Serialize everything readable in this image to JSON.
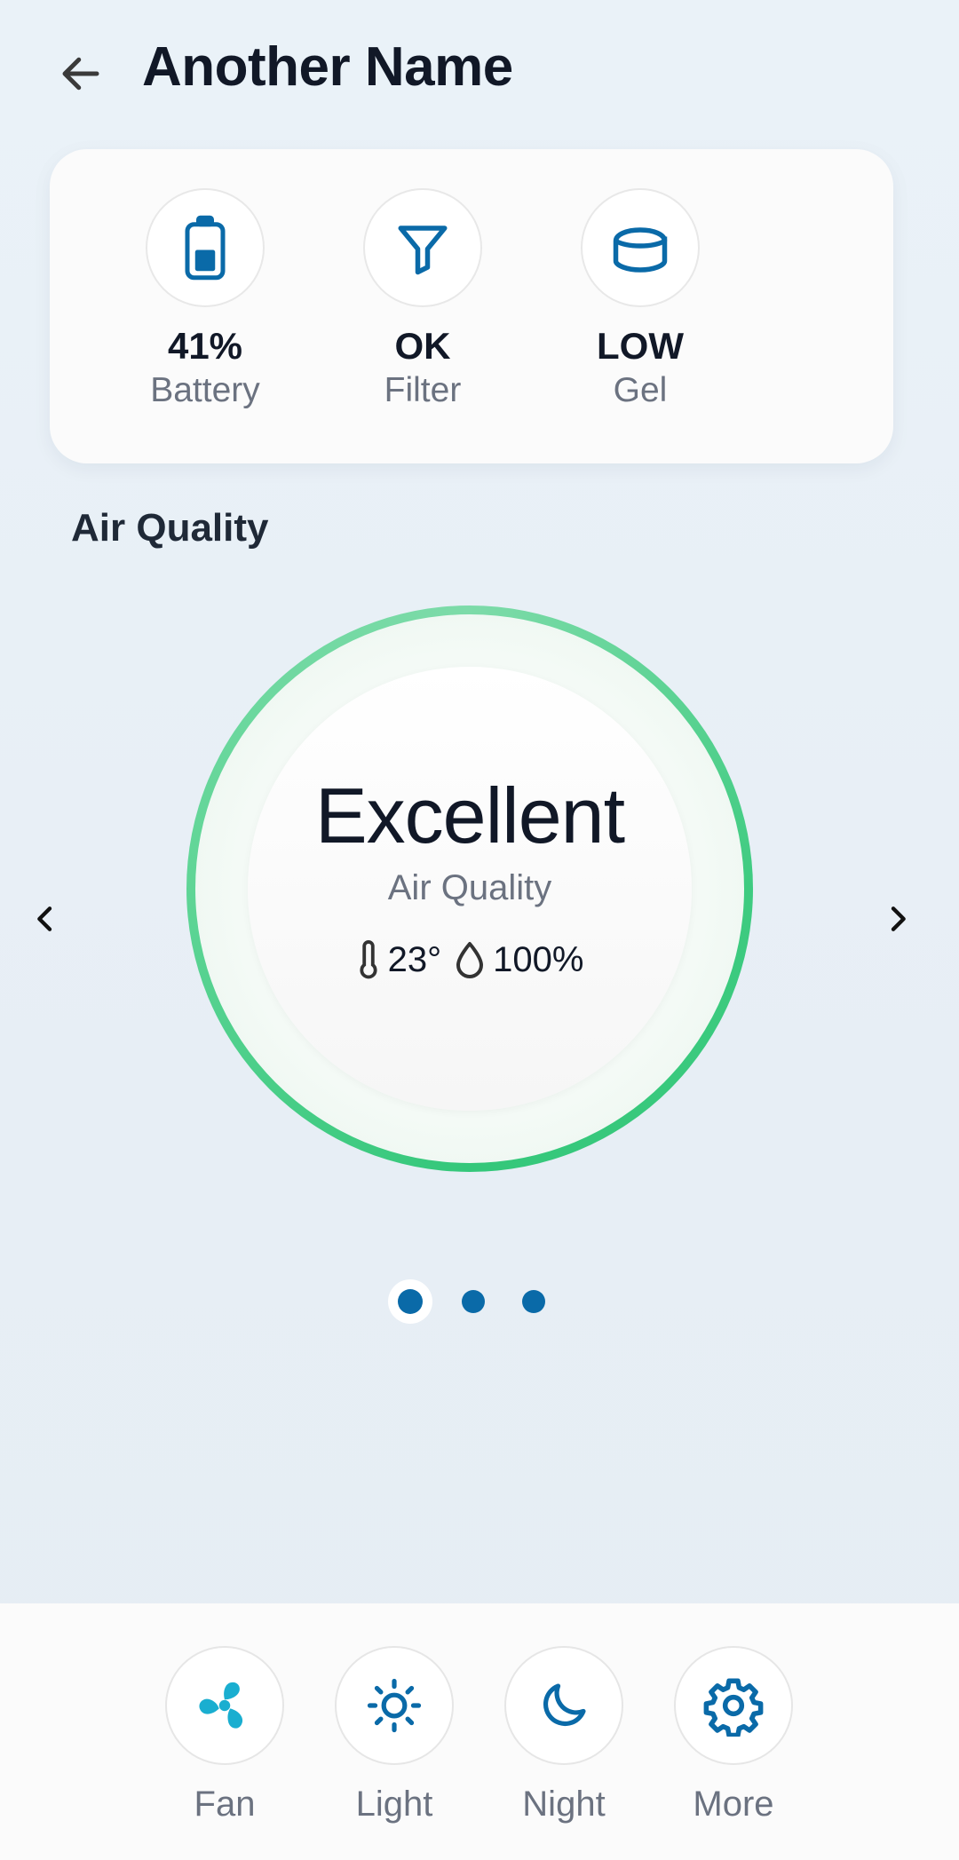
{
  "header": {
    "title": "Another Name",
    "back_icon": "arrow-left-icon"
  },
  "status": [
    {
      "value": "41%",
      "label": "Battery",
      "icon": "battery-icon",
      "fill": 0.41
    },
    {
      "value": "OK",
      "label": "Filter",
      "icon": "filter-icon"
    },
    {
      "value": "LOW",
      "label": "Gel",
      "icon": "gel-container-icon"
    }
  ],
  "air_quality": {
    "section_title": "Air Quality",
    "rating": "Excellent",
    "label": "Air Quality",
    "temperature": "23°",
    "humidity": "100%"
  },
  "pager": {
    "count": 3,
    "active": 0
  },
  "modes": [
    {
      "label": "Fan",
      "icon": "fan-icon"
    },
    {
      "label": "Light",
      "icon": "sun-icon"
    },
    {
      "label": "Night",
      "icon": "moon-icon"
    },
    {
      "label": "More",
      "icon": "gear-icon"
    }
  ],
  "colors": {
    "accent": "#0a6aa8",
    "fan_accent": "#1aaed0",
    "gauge_green": "#3ecb80",
    "title": "#111827",
    "muted": "#6b7280"
  }
}
